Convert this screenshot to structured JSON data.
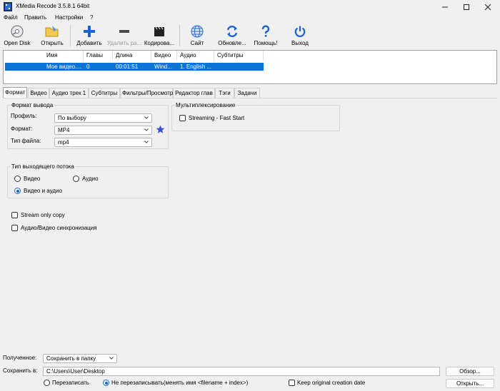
{
  "window": {
    "title": "XMedia Recode 3.5.8.1 64bit"
  },
  "menu": [
    "Файл",
    "Править",
    "Настройки",
    "?"
  ],
  "toolbar": {
    "open_disk": "Open Disk",
    "open": "Открыть",
    "add": "Добавить",
    "remove": "Удалить ра...",
    "encode": "Кодирова...",
    "site": "Сайт",
    "update": "Обновле...",
    "help": "Помощь!",
    "exit": "Выход"
  },
  "file_list": {
    "columns": [
      "Имя",
      "Главы",
      "Длина",
      "Видео",
      "Аудио",
      "Субтитры"
    ],
    "rows": [
      {
        "name": "Мое видео....",
        "chapters": "0",
        "length": "00:01:51",
        "video": "Wind...",
        "audio": "1. English ...",
        "subtitles": ""
      }
    ]
  },
  "tabs": [
    "Формат",
    "Видео",
    "Аудио трек 1",
    "Субтитры",
    "Фильтры/Просмотр",
    "Редактор глав",
    "Тэги",
    "Задачи"
  ],
  "format_output": {
    "title": "Формат вывода",
    "profile_label": "Профиль:",
    "profile_value": "По выбору",
    "format_label": "Формат:",
    "format_value": "MP4",
    "filetype_label": "Тип файла:",
    "filetype_value": "mp4"
  },
  "mux": {
    "title": "Мультиплексирование",
    "streaming_label": "Streaming - Fast Start"
  },
  "stream_type": {
    "title": "Тип выходящего потока",
    "video": "Видео",
    "audio": "Аудио",
    "video_audio": "Видео и аудио"
  },
  "options": {
    "stream_copy": "Stream only copy",
    "av_sync": "Аудио/Видео синхронизация"
  },
  "bottom": {
    "received_label": "Полученное:",
    "received_value": "Сохранить в папку",
    "save_label": "Сохранить в:",
    "save_path": "C:\\Users\\User\\Desktop",
    "browse": "Обзор...",
    "overwrite": "Перезаписать",
    "no_overwrite": "Не перезаписывать(менять имя <filename + index>)",
    "keep_date": "Keep original creation date",
    "open": "Открыть..."
  },
  "colors": {
    "selection": "#0a74d6",
    "accent_blue": "#1565c0",
    "star": "#3b4fd6"
  }
}
